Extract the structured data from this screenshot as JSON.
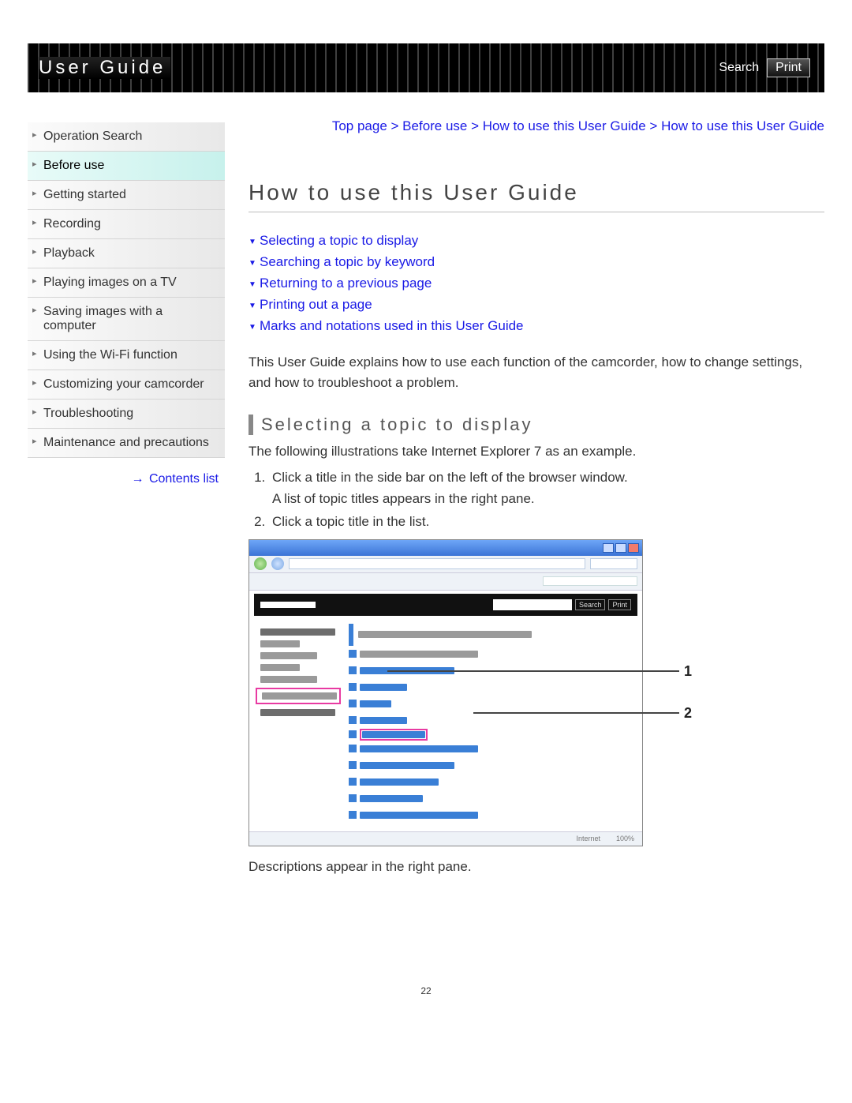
{
  "header": {
    "title": "User Guide",
    "search": "Search",
    "print": "Print"
  },
  "breadcrumb": {
    "parts": [
      "Top page",
      "Before use",
      "How to use this User Guide",
      "How to use this User Guide"
    ]
  },
  "sidebar": {
    "items": [
      {
        "label": "Operation Search"
      },
      {
        "label": "Before use"
      },
      {
        "label": "Getting started"
      },
      {
        "label": "Recording"
      },
      {
        "label": "Playback"
      },
      {
        "label": "Playing images on a TV"
      },
      {
        "label": "Saving images with a computer"
      },
      {
        "label": "Using the Wi-Fi function"
      },
      {
        "label": "Customizing your camcorder"
      },
      {
        "label": "Troubleshooting"
      },
      {
        "label": "Maintenance and precautions"
      }
    ],
    "active_index": 1,
    "contents_list": "Contents list"
  },
  "page": {
    "title": "How to use this User Guide",
    "jump_links": [
      "Selecting a topic to display",
      "Searching a topic by keyword",
      "Returning to a previous page",
      "Printing out a page",
      "Marks and notations used in this User Guide"
    ],
    "intro": "This User Guide explains how to use each function of the camcorder, how to change settings, and how to troubleshoot a problem.",
    "section": {
      "heading": "Selecting a topic to display",
      "note": "The following illustrations take Internet Explorer 7 as an example.",
      "steps": [
        "Click a title in the side bar on the left of the browser window.\nA list of topic titles appears in the right pane.",
        "Click a topic title in the list."
      ],
      "after": "Descriptions appear in the right pane."
    },
    "illustration": {
      "callouts": [
        "1",
        "2"
      ],
      "buttons": {
        "search": "Search",
        "print": "Print"
      },
      "status_hint": "Internet"
    },
    "page_number": "22"
  }
}
